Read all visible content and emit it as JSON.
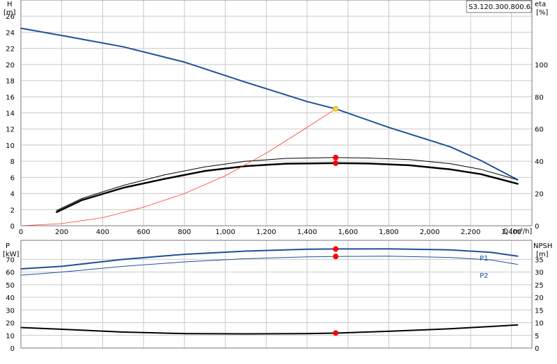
{
  "model_label": "S3.120.300.800.6.",
  "chart_data": [
    {
      "type": "line",
      "panel": "upper",
      "x_axis": {
        "label": "Q [m³/h]",
        "range": [
          0,
          2500
        ],
        "ticks": [
          0,
          200,
          400,
          600,
          800,
          1000,
          1200,
          1400,
          1600,
          1800,
          2000,
          2200,
          2400
        ],
        "tick_labels": [
          "0",
          "200",
          "400",
          "600",
          "800",
          "1,000",
          "1,200",
          "1,400",
          "1,600",
          "1,800",
          "2,000",
          "2,200",
          "2,400"
        ]
      },
      "y_left": {
        "label_top": "H",
        "label_unit": "[m]",
        "range": [
          0,
          28
        ],
        "ticks": [
          0,
          2,
          4,
          6,
          8,
          10,
          12,
          14,
          16,
          18,
          20,
          22,
          24,
          26
        ]
      },
      "y_right": {
        "label_top": "eta",
        "label_unit": "[%]",
        "range": [
          0,
          140
        ],
        "ticks": [
          0,
          20,
          40,
          60,
          80,
          100
        ]
      },
      "grid": true,
      "series": [
        {
          "name": "",
          "axis": "left",
          "color": "#1f4e9a",
          "width": 2,
          "x": [
            0,
            200,
            500,
            800,
            1100,
            1400,
            1540,
            1800,
            2100,
            2250,
            2430
          ],
          "y": [
            24.5,
            23.6,
            22.2,
            20.3,
            17.8,
            15.4,
            14.5,
            12.2,
            9.8,
            8.1,
            5.7
          ]
        },
        {
          "name": "",
          "axis": "right",
          "color": "#000000",
          "width": 1,
          "x": [
            175,
            300,
            500,
            700,
            900,
            1100,
            1300,
            1540,
            1700,
            1900,
            2100,
            2250,
            2430
          ],
          "y": [
            9.5,
            17,
            25,
            31.5,
            36.5,
            40,
            41.8,
            42.3,
            42,
            41,
            38.5,
            35,
            28.5
          ]
        },
        {
          "name": "",
          "axis": "right",
          "color": "#000000",
          "width": 2.5,
          "x": [
            175,
            300,
            500,
            700,
            900,
            1100,
            1300,
            1540,
            1700,
            1900,
            2100,
            2250,
            2430
          ],
          "y": [
            8.5,
            16,
            23.5,
            29,
            34,
            37,
            38.5,
            38.8,
            38.6,
            37.5,
            35,
            32,
            26
          ]
        },
        {
          "name": "",
          "axis": "left",
          "color": "#ff3b30",
          "width": 0.8,
          "x": [
            0,
            200,
            400,
            600,
            800,
            1000,
            1200,
            1400,
            1540
          ],
          "y": [
            0,
            0.27,
            1.0,
            2.3,
            4.0,
            6.2,
            9.0,
            12.2,
            14.5
          ]
        }
      ],
      "points": [
        {
          "axis": "left",
          "x": 1540,
          "y": 14.5,
          "color": "#ffd43b",
          "stroke": "#e0a800"
        },
        {
          "axis": "right",
          "x": 1540,
          "y": 42.3,
          "color": "#ff0000",
          "stroke": "#ff0000"
        },
        {
          "axis": "right",
          "x": 1540,
          "y": 38.8,
          "color": "#ff0000",
          "stroke": "#ff0000"
        }
      ]
    },
    {
      "type": "line",
      "panel": "lower",
      "x_axis": {
        "range": [
          0,
          2500
        ]
      },
      "y_left": {
        "label_top": "P",
        "label_unit": "[kW]",
        "range": [
          0,
          85
        ],
        "ticks": [
          0,
          10,
          20,
          30,
          40,
          50,
          60,
          70
        ]
      },
      "y_right": {
        "label_top": "NPSH",
        "label_unit": "[m]",
        "range": [
          0,
          42.5
        ],
        "ticks": [
          0,
          5,
          10,
          15,
          20,
          25,
          30,
          35
        ]
      },
      "grid": true,
      "series": [
        {
          "name": "P1",
          "axis": "left",
          "color": "#1f4e9a",
          "width": 2,
          "x": [
            0,
            200,
            500,
            800,
            1100,
            1400,
            1540,
            1800,
            2100,
            2300,
            2430
          ],
          "y": [
            62.5,
            64.5,
            70,
            74,
            76.5,
            78,
            78.2,
            78.3,
            77.5,
            75.5,
            72.5
          ]
        },
        {
          "name": "P2",
          "axis": "left",
          "color": "#1f4e9a",
          "width": 1,
          "x": [
            0,
            200,
            500,
            800,
            1100,
            1400,
            1540,
            1800,
            2100,
            2300,
            2430
          ],
          "y": [
            57.5,
            60,
            64.5,
            68,
            70.5,
            72,
            72.3,
            72.5,
            71.5,
            69.5,
            66
          ]
        },
        {
          "name": "",
          "axis": "right",
          "color": "#000000",
          "width": 2,
          "x": [
            0,
            200,
            500,
            800,
            1100,
            1400,
            1540,
            1800,
            2100,
            2300,
            2430
          ],
          "y": [
            8.1,
            7.4,
            6.3,
            5.7,
            5.6,
            5.7,
            5.9,
            6.6,
            7.6,
            8.5,
            9.1
          ]
        }
      ],
      "points": [
        {
          "axis": "left",
          "x": 1540,
          "y": 78.2,
          "color": "#ff0000",
          "stroke": "#ff0000"
        },
        {
          "axis": "left",
          "x": 1540,
          "y": 72.3,
          "color": "#ff0000",
          "stroke": "#ff0000"
        },
        {
          "axis": "right",
          "x": 1540,
          "y": 5.9,
          "color": "#ff0000",
          "stroke": "#ff0000"
        }
      ]
    }
  ]
}
